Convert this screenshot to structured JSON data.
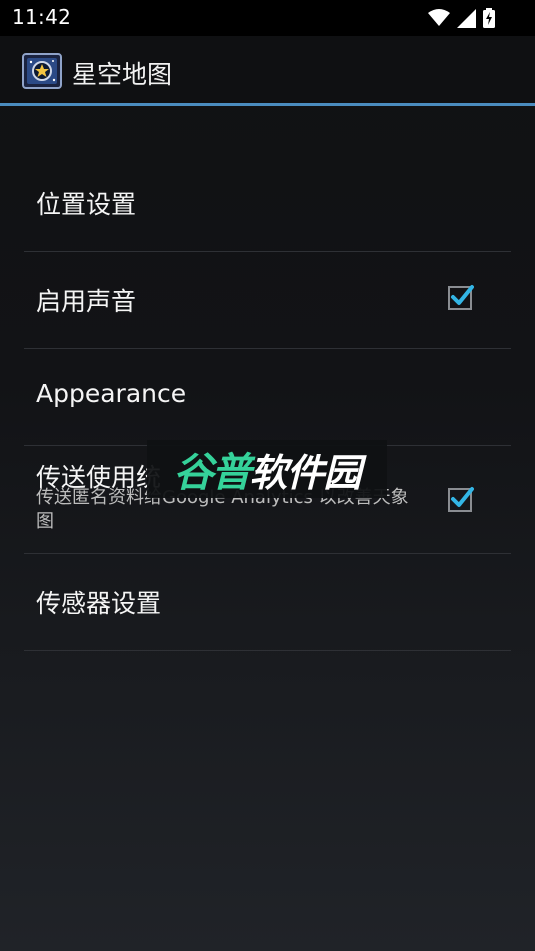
{
  "status_bar": {
    "time": "11:42",
    "icons": [
      "wifi-icon",
      "signal-icon",
      "battery-charging-icon"
    ]
  },
  "action_bar": {
    "title": "星空地图",
    "icon": "star-map-app-icon",
    "accent_color": "#4a8cbf"
  },
  "preferences": [
    {
      "title": "位置设置"
    },
    {
      "title": "启用声音",
      "checkbox": true
    },
    {
      "title": "Appearance"
    },
    {
      "title": "传送使用统",
      "summary": "传送匿名资料给Google Analytics 以改善天象图",
      "checkbox": true
    },
    {
      "title": "传感器设置"
    }
  ],
  "watermark": {
    "part1": "谷普",
    "part2": "软件园"
  },
  "colors": {
    "checkbox_accent": "#33b5e5",
    "watermark_green": "#35d29a"
  }
}
